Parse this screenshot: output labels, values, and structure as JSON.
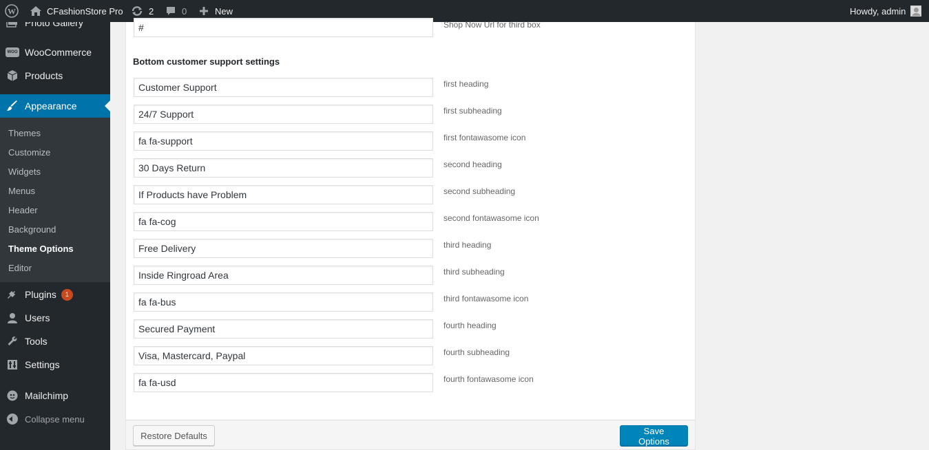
{
  "admin_bar": {
    "site_name": "CFashionStore Pro",
    "updates_count": "2",
    "comments_count": "0",
    "new_label": "New",
    "greeting": "Howdy, admin"
  },
  "sidebar": {
    "photo_gallery": "Photo Gallery",
    "woocommerce": "WooCommerce",
    "woo_icon_text": "WOO",
    "products": "Products",
    "appearance": "Appearance",
    "submenu": [
      "Themes",
      "Customize",
      "Widgets",
      "Menus",
      "Header",
      "Background",
      "Theme Options",
      "Editor"
    ],
    "plugins": "Plugins",
    "plugins_badge": "1",
    "users": "Users",
    "tools": "Tools",
    "settings": "Settings",
    "mailchimp": "Mailchimp",
    "collapse": "Collapse menu"
  },
  "top_field": {
    "value": "#",
    "description": "Shop Now Url for third box"
  },
  "section_title": "Bottom customer support settings",
  "fields": [
    {
      "value": "Customer Support",
      "description": "first heading"
    },
    {
      "value": "24/7 Support",
      "description": "first subheading"
    },
    {
      "value": "fa fa-support",
      "description": "first fontawasome icon"
    },
    {
      "value": "30 Days Return",
      "description": "second heading"
    },
    {
      "value": "If Products have Problem",
      "description": "second subheading"
    },
    {
      "value": "fa fa-cog",
      "description": "second fontawasome icon"
    },
    {
      "value": "Free Delivery",
      "description": "third heading"
    },
    {
      "value": "Inside Ringroad Area",
      "description": "third subheading"
    },
    {
      "value": "fa fa-bus",
      "description": "third fontawasome icon"
    },
    {
      "value": "Secured Payment",
      "description": "fourth heading"
    },
    {
      "value": "Visa, Mastercard, Paypal",
      "description": "fourth subheading"
    },
    {
      "value": "fa fa-usd",
      "description": "fourth fontawasome icon"
    }
  ],
  "buttons": {
    "restore": "Restore Defaults",
    "save": "Save Options"
  },
  "colors": {
    "admin_bar_bg": "#23282d",
    "accent": "#0073aa",
    "primary_button": "#0085ba",
    "badge": "#ca4a1f"
  }
}
